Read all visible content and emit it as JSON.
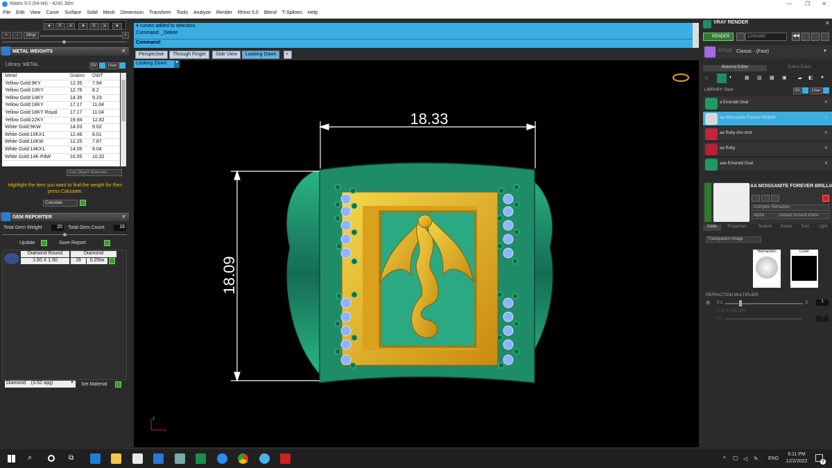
{
  "window": {
    "title": "Matrix 9.0 (64-bit) - 4242.3dm",
    "controls": [
      "—",
      "❐",
      "✕"
    ]
  },
  "menu": [
    "File",
    "Edit",
    "View",
    "Curve",
    "Surface",
    "Solid",
    "Mesh",
    "Dimension",
    "Transform",
    "Tools",
    "Analyze",
    "Render",
    "Rhino 5.0",
    "Blend",
    "T-Splines",
    "Help"
  ],
  "left": {
    "toolbar": {
      "mngr_label": "Mngr"
    },
    "metal_weights": {
      "title": "METAL WEIGHTS",
      "library_label": "Library: METAL",
      "sv_label": "SV",
      "user_label": "User",
      "columns": [
        "Metal",
        "Grams",
        "DWT"
      ],
      "rows": [
        [
          "Yellow Gold:9KY",
          "12.35",
          "7.94"
        ],
        [
          "Yellow Gold:10KY",
          "12.76",
          "8.2"
        ],
        [
          "Yellow Gold:14KY",
          "14.35",
          "9.23"
        ],
        [
          "Yellow Gold:18KY",
          "17.17",
          "11.04"
        ],
        [
          "Yellow Gold:18KY Royal",
          "17.17",
          "11.04"
        ],
        [
          "Yellow Gold:22KY",
          "19.94",
          "12.82"
        ],
        [
          "White Gold:9KW",
          "14.03",
          "9.02"
        ],
        [
          "White Gold:10KX1",
          "12.46",
          "8.01"
        ],
        [
          "White Gold:10KW",
          "12.25",
          "7.87"
        ],
        [
          "White Gold:14KX1",
          "14.05",
          "9.04"
        ],
        [
          "White Gold:14K PdW",
          "16.05",
          "10.32"
        ]
      ],
      "use_object_materials": "Use Object Materials",
      "hint": "Highlight the item you want to find the weight for then press Calculate.",
      "calculate_label": "Calculate"
    },
    "gem_reporter": {
      "title": "GEM REPORTER",
      "total_weight_label": "Total Gem Weight",
      "total_weight_value": "20",
      "total_count_label": "Total Gem Count",
      "total_count_value": "16",
      "update_label": "Update",
      "save_report_label": "Save Report",
      "gem_name": "Diamond Round",
      "gem_material": "Diamond",
      "gem_size": "1.50 X 1.50",
      "gem_count": "16",
      "gem_weight": "0.20tw"
    },
    "material_select": "Diamond    (3.52 spg)",
    "set_material_label": "Set Material"
  },
  "command": {
    "line1": "4 curves added to selection.",
    "line2": "Command: _Delete",
    "prompt_label": "Command:",
    "prompt_value": ""
  },
  "viewport_tabs": [
    "Perspective",
    "Through Finger",
    "Side View",
    "Looking Down",
    "+"
  ],
  "active_tab": "Looking Down",
  "viewport": {
    "title": "Looking Down",
    "dim_width": "18.33",
    "dim_height": "18.09",
    "axis_y": "y",
    "axis_x": "x"
  },
  "right": {
    "title": "VRAY RENDER",
    "render_label": "RENDER",
    "resolution": "1200x900",
    "style_label": "STYLE:",
    "style_value": "Classic - (Fast)",
    "tabs": [
      "Material Editor",
      "Scene Editor"
    ],
    "library_label": "LIBRARY: Gem",
    "sv_label": "SV",
    "user_label": "User",
    "materials": [
      {
        "name": "a Emerald Oval",
        "color": "#1f9a63"
      },
      {
        "name": "aa Moissanite Forever Brilliant",
        "color": "#d8d8d8"
      },
      {
        "name": "aa Ruby cho shot",
        "color": "#c2243a"
      },
      {
        "name": "aa Ruby",
        "color": "#b81e34"
      },
      {
        "name": "aaa Emerald Oval",
        "color": "#1f9a63"
      }
    ],
    "selected_material": "AA MOISSANITE FOREVER BRILLIANT",
    "material_type": "Complex Refraction",
    "alpha_label": "Alpha",
    "ground_plane": "Default Ground Plane",
    "sub_tabs": [
      "Color",
      "Properties",
      "Texture",
      "Scene",
      "Toon",
      "Light"
    ],
    "transparent_label": "Transparent Image",
    "refraction_label": "Refraction",
    "color_label": "Color",
    "multiplier_label": "REFRACTION MULTIPLIER",
    "mult_min": "0.1",
    "mult_max": "5",
    "mult_value": "1",
    "mult_level": 0.2,
    "x_multiplier_label": "X MULTIPLIER",
    "x_min": "0.1",
    "x_value": "1"
  },
  "taskbar": {
    "time": "8:11 PM",
    "date": "12/2/2022",
    "lang": "ENG",
    "notif_count": "6"
  },
  "colors": {
    "accent": "#3aaee0",
    "ring_green": "#1e8c68",
    "gold": "#e8b521",
    "panel": "#2b2b2b"
  }
}
